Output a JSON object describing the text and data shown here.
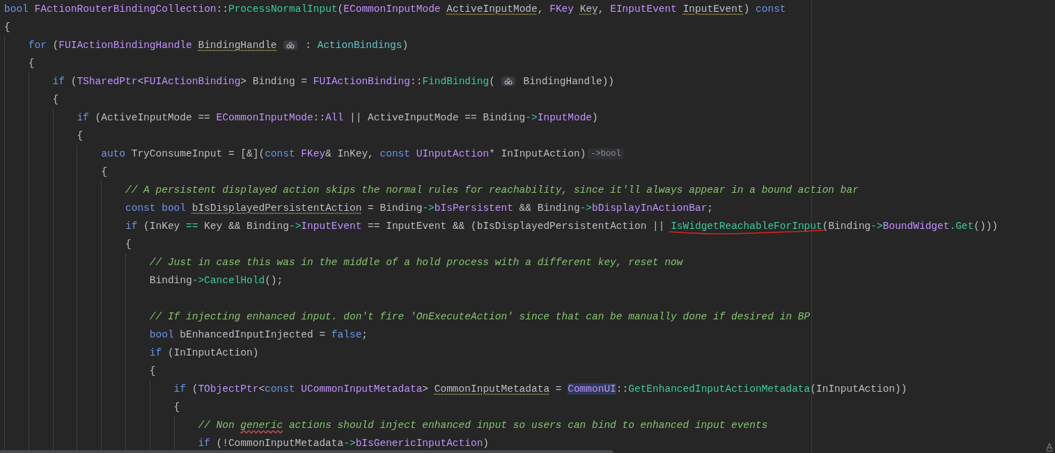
{
  "editor": {
    "lines": [
      {
        "tokens": [
          {
            "text": "bool ",
            "kind": "keyword"
          },
          {
            "text": "FActionRouterBindingCollection",
            "kind": "type"
          },
          {
            "text": "::",
            "kind": "plain"
          },
          {
            "text": "ProcessNormalInput",
            "kind": "function"
          },
          {
            "text": "(",
            "kind": "plain"
          },
          {
            "text": "ECommonInputMode ",
            "kind": "type"
          },
          {
            "text": "ActiveInputMode",
            "kind": "plain",
            "dotted_underline": true
          },
          {
            "text": ", ",
            "kind": "plain"
          },
          {
            "text": "FKey ",
            "kind": "type"
          },
          {
            "text": "Key",
            "kind": "plain",
            "dotted_underline": true
          },
          {
            "text": ", ",
            "kind": "plain"
          },
          {
            "text": "EInputEvent ",
            "kind": "type"
          },
          {
            "text": "InputEvent",
            "kind": "plain",
            "dotted_underline": true
          },
          {
            "text": ") ",
            "kind": "plain"
          },
          {
            "text": "const",
            "kind": "keyword"
          }
        ]
      },
      {
        "tokens": [
          {
            "text": "{",
            "kind": "plain"
          }
        ],
        "children": [
          {
            "tokens": [
              {
                "text": "for",
                "kind": "keyword"
              },
              {
                "text": " (",
                "kind": "plain"
              },
              {
                "text": "FUIActionBindingHandle ",
                "kind": "type"
              },
              {
                "text": "BindingHandle",
                "kind": "plain",
                "dotted_underline": true
              },
              {
                "kind": "parameter-hint"
              },
              {
                "text": " : ",
                "kind": "plain"
              },
              {
                "text": "ActionBindings",
                "kind": "member"
              },
              {
                "text": ")",
                "kind": "plain"
              }
            ]
          },
          {
            "tokens": [
              {
                "text": "{",
                "kind": "plain"
              }
            ],
            "children": [
              {
                "tokens": [
                  {
                    "text": "if",
                    "kind": "keyword"
                  },
                  {
                    "text": " (",
                    "kind": "plain"
                  },
                  {
                    "text": "TSharedPtr",
                    "kind": "type"
                  },
                  {
                    "text": "<",
                    "kind": "plain"
                  },
                  {
                    "text": "FUIActionBinding",
                    "kind": "type"
                  },
                  {
                    "text": "> Binding = ",
                    "kind": "plain"
                  },
                  {
                    "text": "FUIActionBinding",
                    "kind": "type"
                  },
                  {
                    "text": "::",
                    "kind": "plain"
                  },
                  {
                    "text": "FindBinding",
                    "kind": "function"
                  },
                  {
                    "text": "(",
                    "kind": "plain"
                  },
                  {
                    "kind": "parameter-hint"
                  },
                  {
                    "text": " BindingHandle))",
                    "kind": "plain"
                  }
                ]
              },
              {
                "tokens": [
                  {
                    "text": "{",
                    "kind": "plain"
                  }
                ],
                "children": [
                  {
                    "tokens": [
                      {
                        "text": "if",
                        "kind": "keyword"
                      },
                      {
                        "text": " (ActiveInputMode == ",
                        "kind": "plain"
                      },
                      {
                        "text": "ECommonInputMode",
                        "kind": "type"
                      },
                      {
                        "text": "::",
                        "kind": "plain"
                      },
                      {
                        "text": "All",
                        "kind": "type"
                      },
                      {
                        "text": " || ActiveInputMode == Binding",
                        "kind": "plain"
                      },
                      {
                        "text": "->",
                        "kind": "operator"
                      },
                      {
                        "text": "InputMode",
                        "kind": "type"
                      },
                      {
                        "text": ")",
                        "kind": "plain"
                      }
                    ]
                  },
                  {
                    "tokens": [
                      {
                        "text": "{",
                        "kind": "plain"
                      }
                    ],
                    "children": [
                      {
                        "tokens": [
                          {
                            "text": "auto",
                            "kind": "keyword"
                          },
                          {
                            "text": " TryConsumeInput = [&](",
                            "kind": "plain"
                          },
                          {
                            "text": "const ",
                            "kind": "keyword"
                          },
                          {
                            "text": "FKey",
                            "kind": "type"
                          },
                          {
                            "text": "& InKey, ",
                            "kind": "plain"
                          },
                          {
                            "text": "const ",
                            "kind": "keyword"
                          },
                          {
                            "text": "UInputAction",
                            "kind": "type"
                          },
                          {
                            "text": "* InInputAction)",
                            "kind": "plain"
                          },
                          {
                            "text": "->bool",
                            "kind": "type-hint"
                          }
                        ]
                      },
                      {
                        "tokens": [
                          {
                            "text": "{",
                            "kind": "plain"
                          }
                        ],
                        "children": [
                          {
                            "tokens": [
                              {
                                "text": "// A persistent displayed action skips the normal rules for reachability, since it'll always appear in a bound action bar",
                                "kind": "comment"
                              }
                            ]
                          },
                          {
                            "tokens": [
                              {
                                "text": "const ",
                                "kind": "keyword"
                              },
                              {
                                "text": "bool ",
                                "kind": "keyword"
                              },
                              {
                                "text": "bIsDisplayedPersistentAction",
                                "kind": "plain",
                                "dotted_underline": true
                              },
                              {
                                "text": " = Binding",
                                "kind": "plain"
                              },
                              {
                                "text": "->",
                                "kind": "operator"
                              },
                              {
                                "text": "bIsPersistent",
                                "kind": "type"
                              },
                              {
                                "text": " && Binding",
                                "kind": "plain"
                              },
                              {
                                "text": "->",
                                "kind": "operator"
                              },
                              {
                                "text": "bDisplayInActionBar",
                                "kind": "type"
                              },
                              {
                                "text": ";",
                                "kind": "plain"
                              }
                            ]
                          },
                          {
                            "tokens": [
                              {
                                "text": "if",
                                "kind": "keyword"
                              },
                              {
                                "text": " (InKey ",
                                "kind": "plain"
                              },
                              {
                                "text": "==",
                                "kind": "operator"
                              },
                              {
                                "text": " Key && Binding",
                                "kind": "plain"
                              },
                              {
                                "text": "->",
                                "kind": "operator"
                              },
                              {
                                "text": "InputEvent",
                                "kind": "type"
                              },
                              {
                                "text": " == InputEvent && (bIsDisplayedPersistentAction || ",
                                "kind": "plain"
                              },
                              {
                                "text": "IsWidgetReachableForInput",
                                "kind": "function",
                                "annotated": true
                              },
                              {
                                "text": "(Binding",
                                "kind": "plain"
                              },
                              {
                                "text": "->",
                                "kind": "operator"
                              },
                              {
                                "text": "BoundWidget",
                                "kind": "type"
                              },
                              {
                                "text": ".",
                                "kind": "operator"
                              },
                              {
                                "text": "Get",
                                "kind": "function"
                              },
                              {
                                "text": "()))",
                                "kind": "plain"
                              }
                            ]
                          },
                          {
                            "tokens": [
                              {
                                "text": "{",
                                "kind": "plain"
                              }
                            ],
                            "children": [
                              {
                                "tokens": [
                                  {
                                    "text": "// Just in case this was in the middle of a hold process with a different key, reset now",
                                    "kind": "comment"
                                  }
                                ]
                              },
                              {
                                "tokens": [
                                  {
                                    "text": "Binding",
                                    "kind": "plain"
                                  },
                                  {
                                    "text": "->",
                                    "kind": "operator"
                                  },
                                  {
                                    "text": "CancelHold",
                                    "kind": "function"
                                  },
                                  {
                                    "text": "();",
                                    "kind": "plain"
                                  }
                                ]
                              },
                              {
                                "kind": "blank"
                              },
                              {
                                "tokens": [
                                  {
                                    "text": "// If injecting enhanced input. don't fire 'OnExecuteAction' since that can be manually done if desired in BP",
                                    "kind": "comment"
                                  }
                                ]
                              },
                              {
                                "tokens": [
                                  {
                                    "text": "bool",
                                    "kind": "keyword"
                                  },
                                  {
                                    "text": " bEnhancedInputInjected = ",
                                    "kind": "plain"
                                  },
                                  {
                                    "text": "false",
                                    "kind": "keyword"
                                  },
                                  {
                                    "text": ";",
                                    "kind": "plain"
                                  }
                                ]
                              },
                              {
                                "tokens": [
                                  {
                                    "text": "if",
                                    "kind": "keyword"
                                  },
                                  {
                                    "text": " (InInputAction)",
                                    "kind": "plain"
                                  }
                                ]
                              },
                              {
                                "tokens": [
                                  {
                                    "text": "{",
                                    "kind": "plain"
                                  }
                                ],
                                "children": [
                                  {
                                    "tokens": [
                                      {
                                        "text": "if",
                                        "kind": "keyword"
                                      },
                                      {
                                        "text": " (",
                                        "kind": "plain"
                                      },
                                      {
                                        "text": "TObjectPtr",
                                        "kind": "type"
                                      },
                                      {
                                        "text": "<",
                                        "kind": "plain"
                                      },
                                      {
                                        "text": "const ",
                                        "kind": "keyword"
                                      },
                                      {
                                        "text": "UCommonInputMetadata",
                                        "kind": "type"
                                      },
                                      {
                                        "text": "> ",
                                        "kind": "plain"
                                      },
                                      {
                                        "text": "CommonInputMetadata",
                                        "kind": "plain",
                                        "dotted_underline": true
                                      },
                                      {
                                        "text": " = ",
                                        "kind": "plain"
                                      },
                                      {
                                        "text": "CommonUI",
                                        "kind": "type",
                                        "highlighted": true
                                      },
                                      {
                                        "text": "::",
                                        "kind": "plain"
                                      },
                                      {
                                        "text": "GetEnhancedInputActionMetadata",
                                        "kind": "function"
                                      },
                                      {
                                        "text": "(InInputAction))",
                                        "kind": "plain"
                                      }
                                    ]
                                  },
                                  {
                                    "tokens": [
                                      {
                                        "text": "{",
                                        "kind": "plain"
                                      }
                                    ],
                                    "children": [
                                      {
                                        "tokens": [
                                          {
                                            "text": "// Non ",
                                            "kind": "comment"
                                          },
                                          {
                                            "text": "generic",
                                            "kind": "comment",
                                            "spelling_error": true
                                          },
                                          {
                                            "text": " actions should inject enhanced input so users can bind to enhanced input events",
                                            "kind": "comment"
                                          }
                                        ]
                                      },
                                      {
                                        "tokens": [
                                          {
                                            "text": "if",
                                            "kind": "keyword"
                                          },
                                          {
                                            "text": " (!CommonInputMetadata",
                                            "kind": "plain"
                                          },
                                          {
                                            "text": "->",
                                            "kind": "operator"
                                          },
                                          {
                                            "text": "bIsGenericInputAction",
                                            "kind": "type"
                                          },
                                          {
                                            "text": ")",
                                            "kind": "plain"
                                          }
                                        ]
                                      }
                                    ]
                                  }
                                ]
                              }
                            ]
                          }
                        ]
                      }
                    ]
                  }
                ]
              }
            ]
          }
        ]
      }
    ]
  }
}
